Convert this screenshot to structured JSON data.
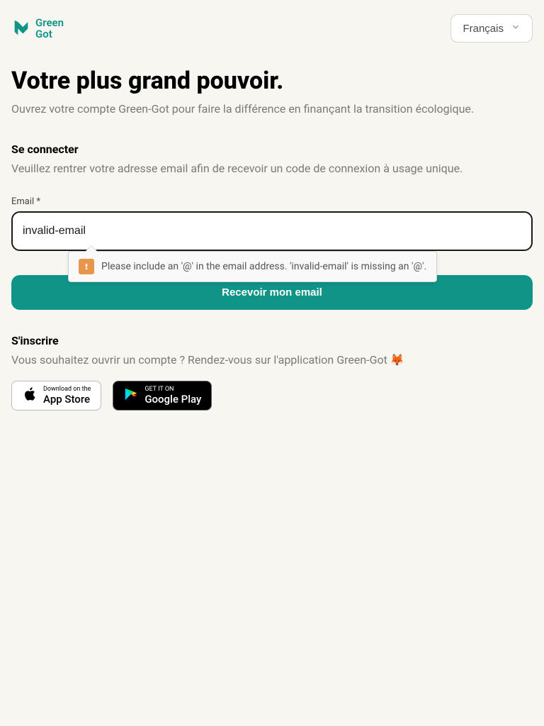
{
  "header": {
    "logo_text": "Green\nGot",
    "language_label": "Français"
  },
  "hero": {
    "title": "Votre plus grand pouvoir.",
    "subtitle": "Ouvrez votre compte Green-Got pour faire la différence en finançant la transition écologique."
  },
  "signin": {
    "title": "Se connecter",
    "subtitle": "Veuillez rentrer votre adresse email afin de recevoir un code de connexion à usage unique.",
    "email_label": "Email ",
    "email_required_mark": "*",
    "email_value": "invalid-email",
    "validation_message": "Please include an '@' in the email address. 'invalid-email' is missing an '@'.",
    "submit_label": "Recevoir mon email"
  },
  "signup": {
    "title": "S'inscrire",
    "subtitle": "Vous souhaitez ouvrir un compte ? Rendez-vous sur l'application Green-Got 🦊"
  },
  "stores": {
    "apple_small": "Download on the",
    "apple_large": "App Store",
    "google_small": "GET IT ON",
    "google_large": "Google Play"
  },
  "colors": {
    "brand": "#0f9487",
    "background": "#f7f6f0",
    "warning": "#e8964a"
  }
}
